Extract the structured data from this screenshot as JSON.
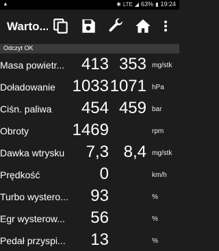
{
  "status_bar": {
    "left_icon": "warning-triangle-icon",
    "battery": "63%",
    "time": "19:24",
    "network": "LTE"
  },
  "app_bar": {
    "title": "Warto...",
    "icons": [
      "copy-icon",
      "save-icon",
      "wrench-icon",
      "home-icon",
      "more-vert-icon"
    ]
  },
  "status_text": "Odczyt OK",
  "rows": [
    {
      "label": "Masa powietr...",
      "v1": "413",
      "v2": "353",
      "unit": "mg/stk"
    },
    {
      "label": "Doładowanie",
      "v1": "1033",
      "v2": "1071",
      "unit": "hPa"
    },
    {
      "label": "Ciśn. paliwa",
      "v1": "454",
      "v2": "459",
      "unit": "bar"
    },
    {
      "label": "Obroty",
      "v1": "1469",
      "v2": "",
      "unit": "rpm"
    },
    {
      "label": "Dawka wtrysku",
      "v1": "7,3",
      "v2": "8,4",
      "unit": "mg/stk"
    },
    {
      "label": "Prędkość",
      "v1": "0",
      "v2": "",
      "unit": "km/h"
    },
    {
      "label": "Turbo wystero...",
      "v1": "93",
      "v2": "",
      "unit": "%"
    },
    {
      "label": "Egr wysterow...",
      "v1": "56",
      "v2": "",
      "unit": "%"
    },
    {
      "label": "Pedał przyspi...",
      "v1": "13",
      "v2": "",
      "unit": "%"
    }
  ]
}
